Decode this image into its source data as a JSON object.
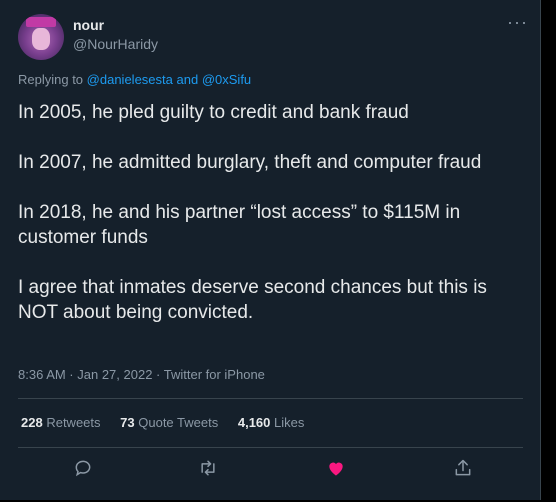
{
  "author": {
    "name": "nour",
    "handle": "@NourHaridy"
  },
  "reply": {
    "prefix": "Replying to",
    "user1": "@danielesesta",
    "conj": "and",
    "user2": "@0xSifu"
  },
  "tweet": {
    "p1": "In 2005, he pled guilty to credit and bank fraud",
    "p2": "In 2007, he admitted burglary, theft and computer fraud",
    "p3": "In 2018, he and his partner “lost access” to $115M in customer funds",
    "p4": "I agree that inmates deserve second chances but this is NOT about being convicted."
  },
  "meta": {
    "time": "8:36 AM · Jan 27, 2022 · Twitter for iPhone"
  },
  "stats": {
    "retweets_count": "228",
    "retweets_label": "Retweets",
    "quotes_count": "73",
    "quotes_label": "Quote Tweets",
    "likes_count": "4,160",
    "likes_label": "Likes"
  },
  "icons": {
    "more": "more-icon",
    "reply": "reply-icon",
    "retweet": "retweet-icon",
    "like": "heart-icon",
    "share": "share-icon"
  },
  "colors": {
    "link": "#1d9bf0",
    "like": "#f91880",
    "background": "#15202b"
  }
}
